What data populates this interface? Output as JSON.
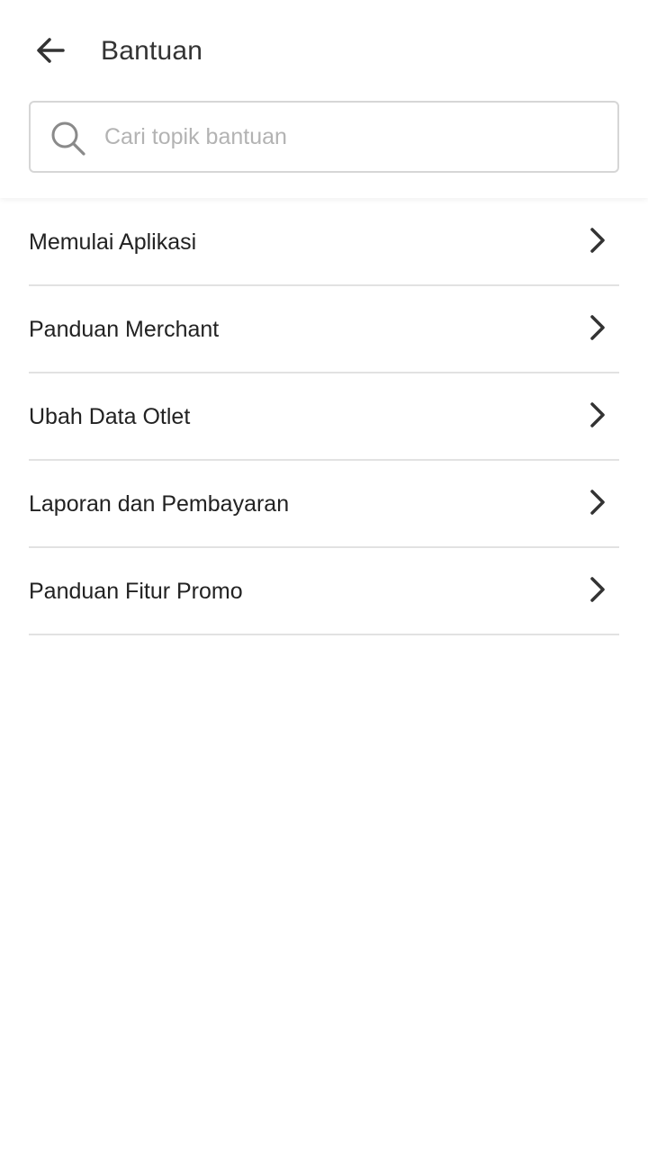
{
  "header": {
    "title": "Bantuan",
    "back_icon": "arrow-left-icon"
  },
  "search": {
    "placeholder": "Cari topik bantuan",
    "value": "",
    "icon": "search-icon"
  },
  "topics": [
    {
      "label": "Memulai Aplikasi",
      "icon": "chevron-right-icon"
    },
    {
      "label": "Panduan Merchant",
      "icon": "chevron-right-icon"
    },
    {
      "label": "Ubah Data Otlet",
      "icon": "chevron-right-icon"
    },
    {
      "label": "Laporan dan Pembayaran",
      "icon": "chevron-right-icon"
    },
    {
      "label": "Panduan Fitur Promo",
      "icon": "chevron-right-icon"
    }
  ],
  "colors": {
    "background": "#ffffff",
    "text": "#222222",
    "divider": "#e2e2e2",
    "placeholder": "#b3b3b3",
    "border": "#d6d6d6"
  }
}
